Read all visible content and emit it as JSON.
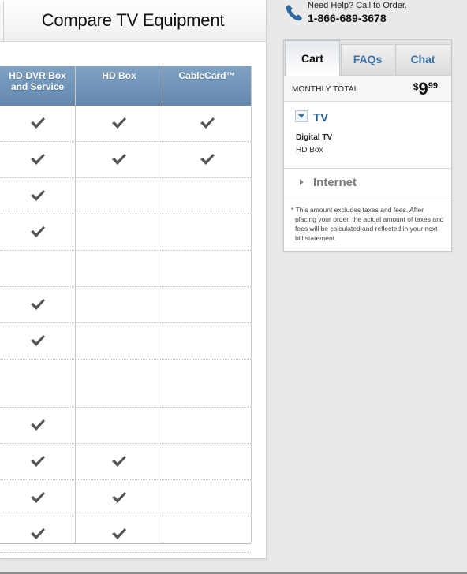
{
  "panel": {
    "title": "Compare TV Equipment"
  },
  "columns": [
    {
      "label_line1": "HD-DVR Box",
      "label_line2": "and Service"
    },
    {
      "label_line1": "HD Box",
      "label_line2": ""
    },
    {
      "label_line1": "CableCard™",
      "label_line2": ""
    }
  ],
  "rows": [
    [
      true,
      true,
      true
    ],
    [
      true,
      true,
      true
    ],
    [
      true,
      false,
      false
    ],
    [
      true,
      false,
      false
    ],
    [
      false,
      false,
      false
    ],
    [
      true,
      false,
      false
    ],
    [
      true,
      false,
      false
    ],
    [
      false,
      false,
      false
    ],
    [
      true,
      false,
      false
    ],
    [
      true,
      true,
      false
    ],
    [
      true,
      true,
      false
    ],
    [
      true,
      true,
      false
    ]
  ],
  "help": {
    "text": "Need Help? Call to Order.",
    "phone": "1-866-689-3678",
    "icon": "phone-icon"
  },
  "cart": {
    "tabs": [
      "Cart",
      "FAQs",
      "Chat"
    ],
    "active_tab": "Cart",
    "monthly_label": "MONTHLY TOTAL",
    "price_currency": "$",
    "price_dollars": "9",
    "price_cents": "99",
    "tv_title": "TV",
    "tv_line1": "Digital TV",
    "tv_line2": "HD Box",
    "internet_title": "Internet",
    "disclaimer": "* This amount excludes taxes and fees. After placing your order, the actual amount of taxes and fees will be calculated and reflected in your next bill statement."
  },
  "colors": {
    "header_blue": "#6f93b7",
    "link_blue": "#3b74a8",
    "tv_blue": "#2a5f92"
  }
}
